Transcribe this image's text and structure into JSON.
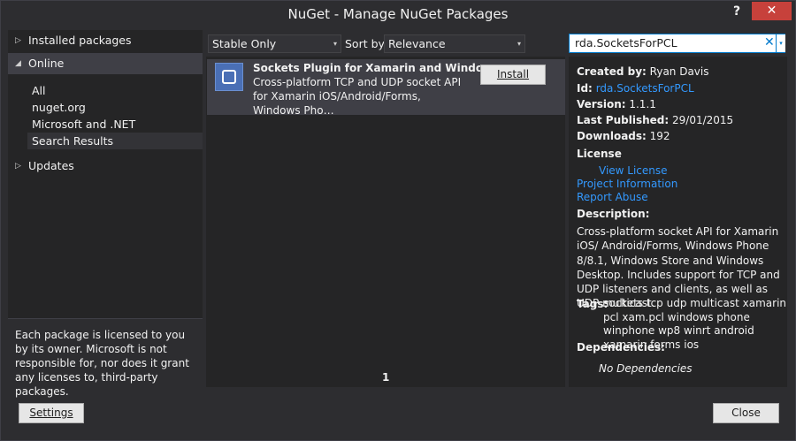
{
  "window": {
    "title": "NuGet - Manage NuGet Packages",
    "help_label": "?",
    "close_label": "✕"
  },
  "sidebar": {
    "installed": {
      "label": "Installed packages",
      "arrow": "▷"
    },
    "online": {
      "label": "Online",
      "arrow": "◢"
    },
    "online_items": [
      "All",
      "nuget.org",
      "Microsoft and .NET",
      "Search Results"
    ],
    "updates": {
      "label": "Updates",
      "arrow": "▷"
    },
    "license_note": "Each package is licensed to you by its owner. Microsoft is not responsible for, nor does it grant any licenses to, third-party packages."
  },
  "toolbar": {
    "filter_value": "Stable Only",
    "sort_label": "Sort by:",
    "sort_value": "Relevance",
    "search_value": "rda.SocketsForPCL",
    "search_clear": "✕",
    "dropdown_glyph": "▾"
  },
  "package_list": {
    "items": [
      {
        "name": "Sockets Plugin for Xamarin and Windows…",
        "description": "Cross-platform TCP and UDP socket API for Xamarin iOS/Android/Forms, Windows Pho…",
        "install_label": "Install"
      }
    ],
    "page": "1"
  },
  "details": {
    "created_by_label": "Created by:",
    "created_by": "Ryan Davis",
    "id_label": "Id:",
    "id": "rda.SocketsForPCL",
    "version_label": "Version:",
    "version": "1.1.1",
    "published_label": "Last Published:",
    "published": "29/01/2015",
    "downloads_label": "Downloads:",
    "downloads": "192",
    "license_label": "License",
    "view_license": "View License",
    "project_info": "Project Information",
    "report_abuse": "Report Abuse",
    "description_label": "Description:",
    "description": "Cross-platform socket API for Xamarin iOS/ Android/Forms, Windows Phone 8/8.1, Windows Store and Windows Desktop. Includes support for TCP and UDP listeners and clients, as well as UDP multicast.",
    "tags_label": "Tags:",
    "tags": "sockets tcp udp multicast xamarin pcl xam.pcl windows phone winphone wp8 winrt android xamarin.forms ios",
    "dependencies_label": "Dependencies:",
    "dependencies": "No Dependencies"
  },
  "footer": {
    "settings_label": "Settings",
    "close_label": "Close"
  },
  "colors": {
    "background": "#2d2d30",
    "panel": "#252526",
    "selection": "#3f3f46",
    "link": "#3399ff",
    "accent": "#007acc",
    "close_button": "#c7413b"
  }
}
